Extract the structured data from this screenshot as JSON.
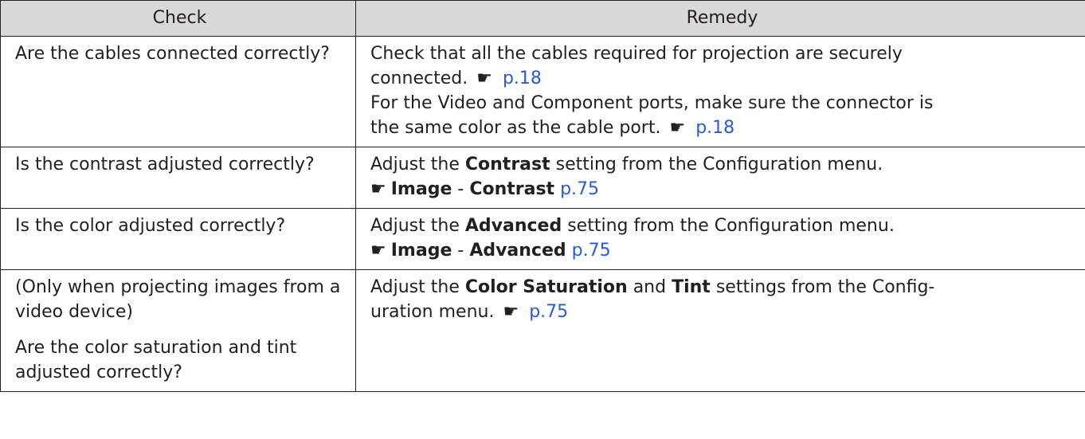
{
  "headers": {
    "check": "Check",
    "remedy": "Remedy"
  },
  "rows": [
    {
      "check": [
        "Are the cables connected correctly?"
      ],
      "remedy": {
        "line1": "Check that all the cables required for projection are securely",
        "line2": "connected.",
        "link1": "p.18",
        "line3": "For the Video and Component ports, make sure the connector is",
        "line4": "the same color as the cable port.",
        "link2": "p.18"
      }
    },
    {
      "check": [
        "Is the contrast adjusted correctly?"
      ],
      "remedy": {
        "pre": "Adjust the",
        "setting": "Contrast",
        "post": "setting from the Configuration menu.",
        "menu": "Image",
        "sep": "-",
        "item": "Contrast",
        "link": "p.75"
      }
    },
    {
      "check": [
        "Is the color adjusted correctly?"
      ],
      "remedy": {
        "pre": "Adjust the",
        "setting": "Advanced",
        "post": "setting from the Configuration menu.",
        "menu": "Image",
        "sep": "-",
        "item": "Advanced",
        "link": "p.75"
      }
    },
    {
      "check": [
        "(Only when projecting images from a video device)",
        "Are the color saturation and tint adjusted correctly?"
      ],
      "remedy": {
        "pre": "Adjust the",
        "setting1": "Color Saturation",
        "and": "and",
        "setting2": "Tint",
        "post": "settings from the Config-",
        "line2": "uration menu.",
        "link": "p.75"
      }
    }
  ],
  "icons": {
    "pointer": "pointing-hand-icon"
  }
}
